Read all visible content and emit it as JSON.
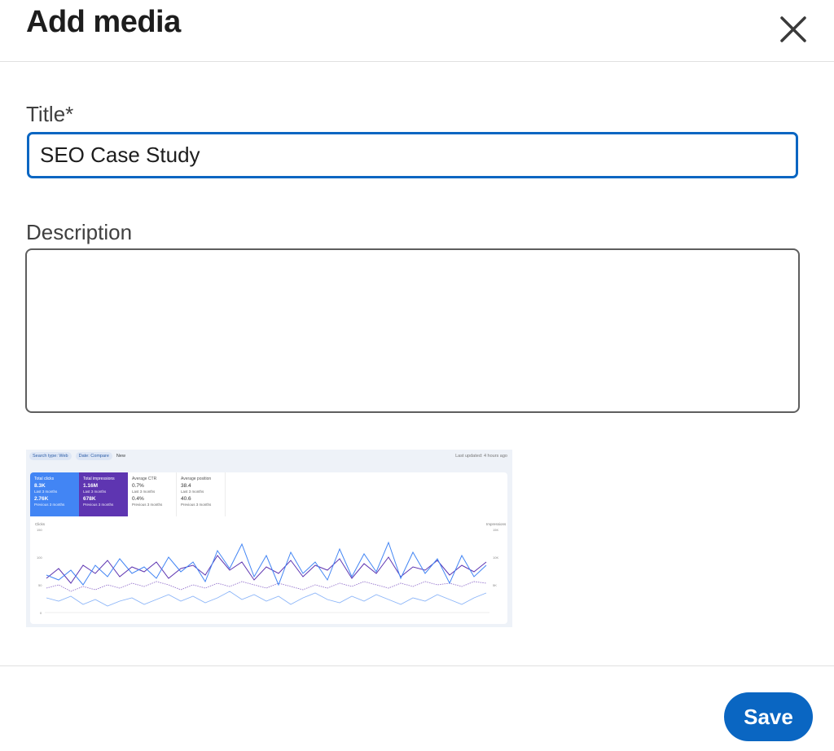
{
  "dialog": {
    "title": "Add media",
    "close_icon": "close-icon"
  },
  "form": {
    "title_label": "Title*",
    "title_value": "SEO Case Study",
    "description_label": "Description",
    "description_value": ""
  },
  "thumbnail": {
    "chips": [
      "Search type: Web",
      "Date: Compare",
      "New"
    ],
    "last_updated": "Last updated: 4 hours ago",
    "cards": [
      {
        "label": "Total clicks",
        "value": "8.3K",
        "sub": "Last 3 months",
        "value2": "2.76K",
        "sub2": "Previous 3 months"
      },
      {
        "label": "Total impressions",
        "value": "1.16M",
        "sub": "Last 3 months",
        "value2": "678K",
        "sub2": "Previous 3 months"
      },
      {
        "label": "Average CTR",
        "value": "0.7%",
        "sub": "Last 3 months",
        "value2": "0.4%",
        "sub2": "Previous 3 months"
      },
      {
        "label": "Average position",
        "value": "38.4",
        "sub": "Last 3 months",
        "value2": "40.6",
        "sub2": "Previous 3 months"
      }
    ],
    "chart": {
      "left_axis_title": "Clicks",
      "right_axis_title": "Impressions",
      "left_ticks": [
        "150",
        "100",
        "50",
        "0"
      ],
      "right_ticks": [
        "15K",
        "10K",
        "5K"
      ],
      "colors": {
        "clicks": "#4285f4",
        "impressions": "#5e35b1",
        "clicks_prev": "#8ab4f8",
        "impressions_prev": "#9575cd"
      }
    }
  },
  "footer": {
    "save_label": "Save"
  }
}
